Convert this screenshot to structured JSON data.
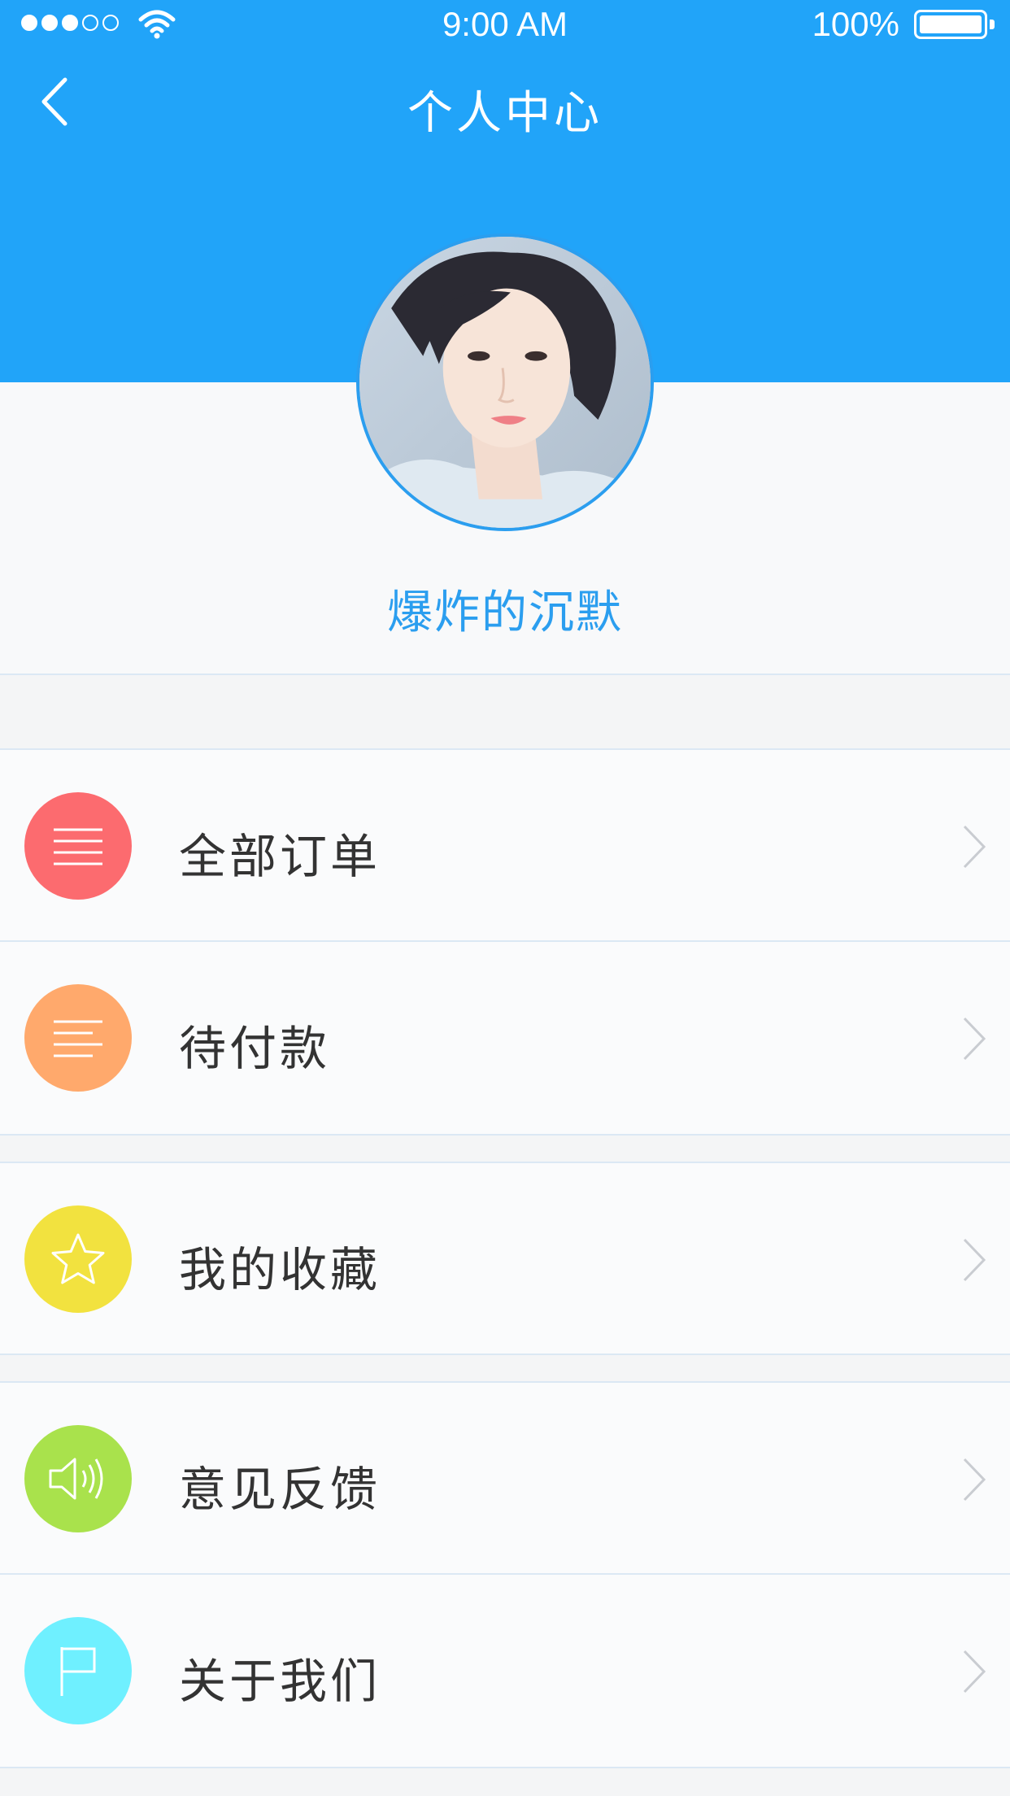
{
  "status_bar": {
    "time": "9:00 AM",
    "battery": "100%",
    "signal_bars_filled": 3,
    "signal_bars_total": 5
  },
  "nav": {
    "title": "个人中心",
    "back_icon": "chevron-left-icon"
  },
  "profile": {
    "username": "爆炸的沉默",
    "avatar": "avatar-photo"
  },
  "colors": {
    "header": "#21a4f9",
    "accent_text": "#2b9eef",
    "orders": "#fc6b6f",
    "pending_payment": "#ffa96c",
    "favorites": "#f2e23f",
    "feedback": "#a9e24c",
    "about": "#6ff0ff"
  },
  "menu": {
    "items": [
      {
        "label": "全部订单",
        "icon": "list-icon"
      },
      {
        "label": "待付款",
        "icon": "list-icon"
      },
      {
        "label": "我的收藏",
        "icon": "star-icon"
      },
      {
        "label": "意见反馈",
        "icon": "speaker-icon"
      },
      {
        "label": "关于我们",
        "icon": "flag-icon"
      }
    ]
  }
}
